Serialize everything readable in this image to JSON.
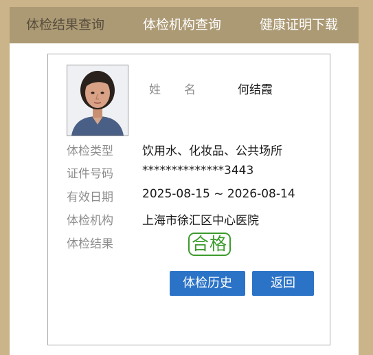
{
  "tabs": [
    {
      "label": "体检结果查询"
    },
    {
      "label": "体检机构查询"
    },
    {
      "label": "健康证明下载"
    }
  ],
  "person": {
    "name_label": "姓　　名",
    "name": "何结霞"
  },
  "fields": [
    {
      "label": "体检类型",
      "value": "饮用水、化妆品、公共场所"
    },
    {
      "label": "证件号码",
      "value": "**************3443"
    },
    {
      "label": "有效日期",
      "value": "2025-08-15 ~ 2026-08-14"
    },
    {
      "label": "体检机构",
      "value": "上海市徐汇区中心医院"
    },
    {
      "label": "体检结果",
      "value": ""
    }
  ],
  "result_stamp": "合格",
  "buttons": {
    "history": "体检历史",
    "back": "返回"
  },
  "colors": {
    "page_background": "#cbb489",
    "tabbar": "#ac9a75",
    "button": "#2b73c7",
    "pass_stamp": "#3c9b2c"
  }
}
